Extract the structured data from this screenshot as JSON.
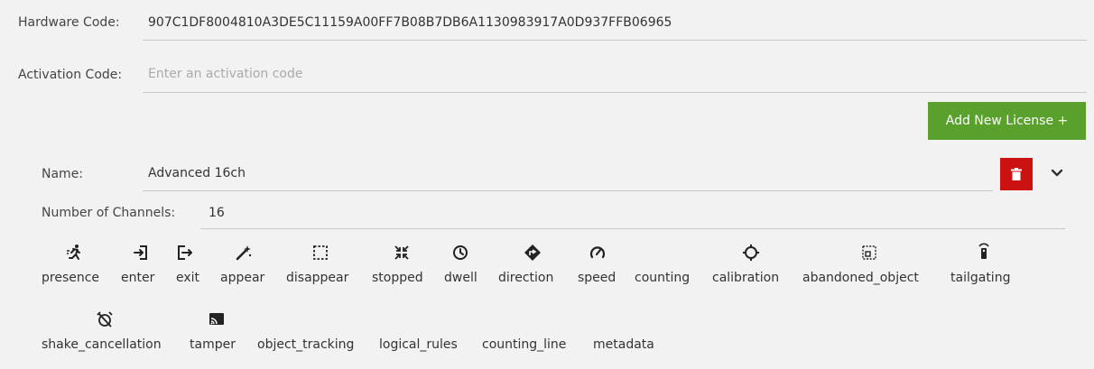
{
  "hardware": {
    "label": "Hardware Code:",
    "value": "907C1DF8004810A3DE5C11159A00FF7B08B7DB6A1130983917A0D937FFB06965"
  },
  "activation": {
    "label": "Activation Code:",
    "placeholder": "Enter an activation code"
  },
  "add_license_button": "Add New License +",
  "license": {
    "name_label": "Name:",
    "name_value": "Advanced 16ch",
    "channels_label": "Number of Channels:",
    "channels_value": "16"
  },
  "features_row1": [
    {
      "label": "presence",
      "icon": "running-person-icon"
    },
    {
      "label": "enter",
      "icon": "enter-icon"
    },
    {
      "label": "exit",
      "icon": "exit-icon"
    },
    {
      "label": "appear",
      "icon": "magic-wand-icon"
    },
    {
      "label": "disappear",
      "icon": "dashed-square-icon"
    },
    {
      "label": "stopped",
      "icon": "collapse-arrows-icon"
    },
    {
      "label": "dwell",
      "icon": "clock-icon"
    },
    {
      "label": "direction",
      "icon": "direction-sign-icon"
    },
    {
      "label": "speed",
      "icon": "speedometer-icon"
    },
    {
      "label": "counting",
      "icon": ""
    },
    {
      "label": "calibration",
      "icon": "crosshair-icon"
    },
    {
      "label": "abandoned_object",
      "icon": "abandoned-box-icon"
    },
    {
      "label": "tailgating",
      "icon": "remote-icon"
    }
  ],
  "features_row2": [
    {
      "label": "shake_cancellation",
      "icon": "alarm-off-icon"
    },
    {
      "label": "tamper",
      "icon": "cast-icon"
    },
    {
      "label": "object_tracking",
      "icon": ""
    },
    {
      "label": "logical_rules",
      "icon": ""
    },
    {
      "label": "counting_line",
      "icon": ""
    },
    {
      "label": "metadata",
      "icon": ""
    }
  ],
  "colors": {
    "add_button": "#5aa02c",
    "delete_button": "#cc1111",
    "background": "#f2f2f2"
  }
}
